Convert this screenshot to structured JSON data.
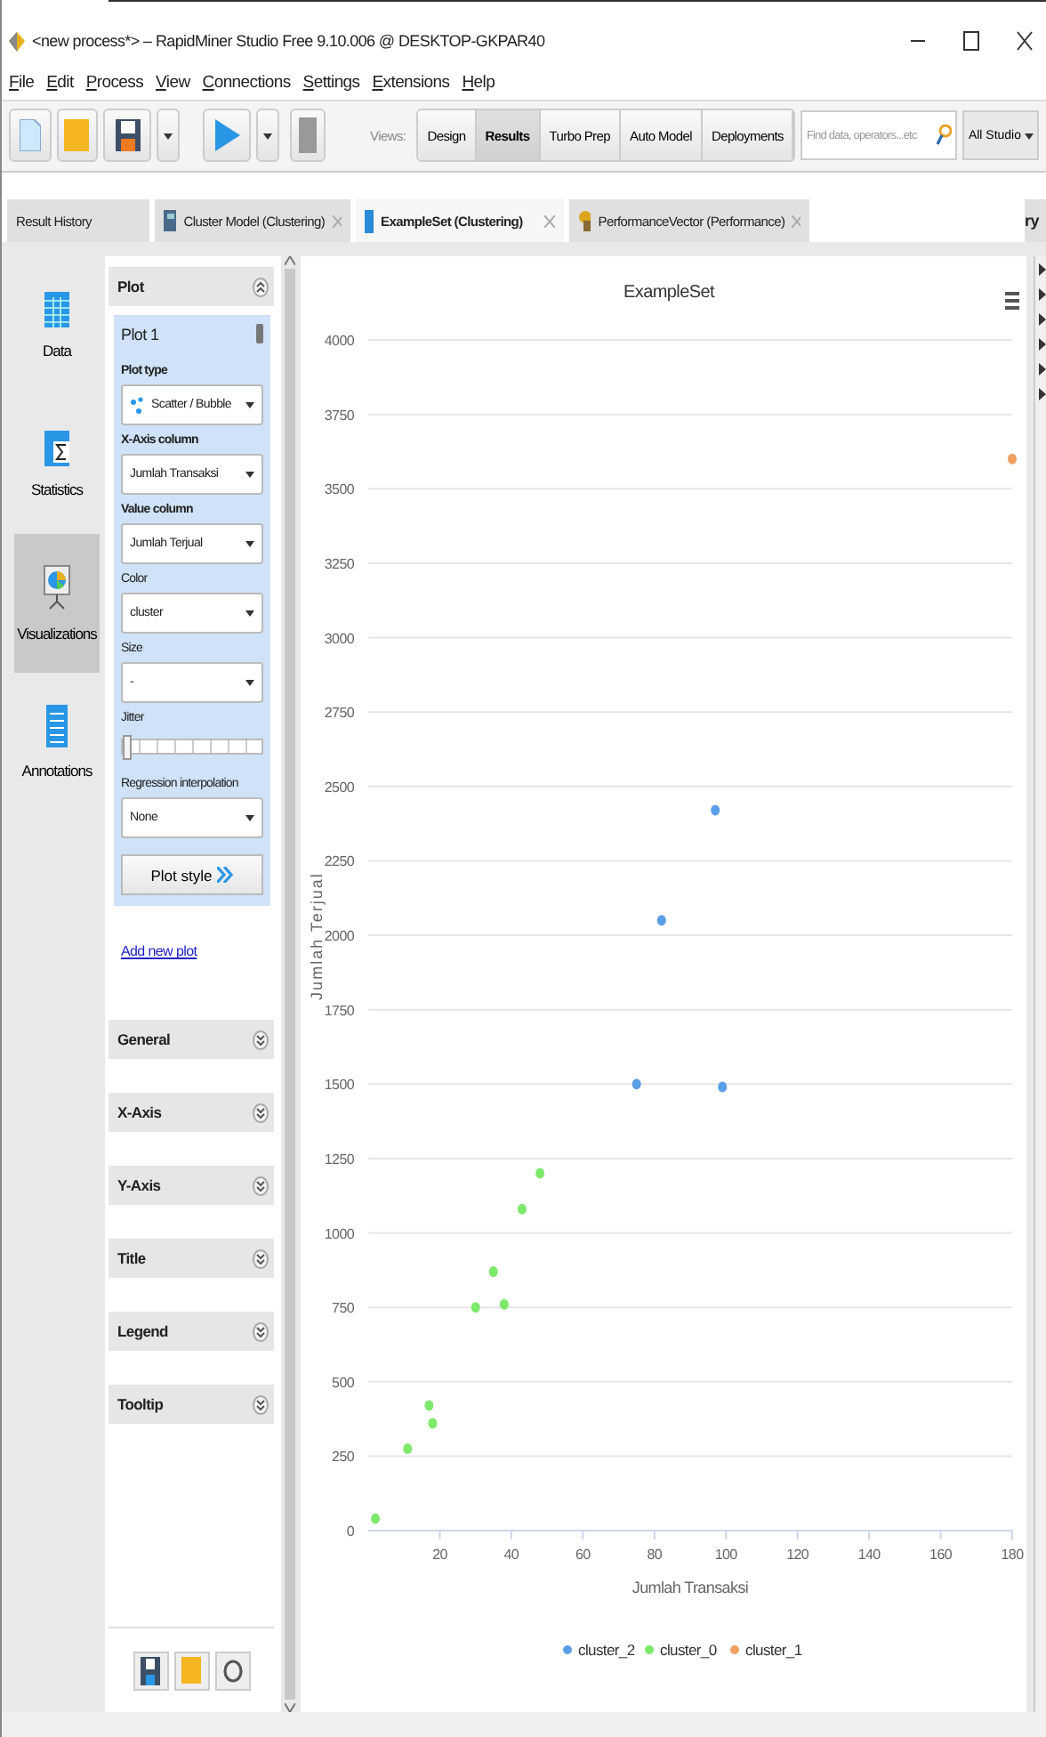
{
  "window": {
    "title": "<new process*> – RapidMiner Studio Free 9.10.006 @ DESKTOP-GKPAR40"
  },
  "menu": [
    "File",
    "Edit",
    "Process",
    "View",
    "Connections",
    "Settings",
    "Extensions",
    "Help"
  ],
  "toolbar": {
    "views_label": "Views:",
    "views": [
      {
        "label": "Design",
        "selected": false
      },
      {
        "label": "Results",
        "selected": true
      },
      {
        "label": "Turbo Prep",
        "selected": false
      },
      {
        "label": "Auto Model",
        "selected": false
      },
      {
        "label": "Deployments",
        "selected": false
      }
    ],
    "search": {
      "placeholder": "Find data, operators...etc"
    },
    "scope": "All Studio"
  },
  "tabs": [
    {
      "label": "Result History",
      "kind": "plain",
      "selected": false
    },
    {
      "label": "Cluster Model (Clustering)",
      "kind": "model",
      "selected": false
    },
    {
      "label": "ExampleSet (Clustering)",
      "kind": "data",
      "selected": true
    },
    {
      "label": "PerformanceVector (Performance)",
      "kind": "performance",
      "selected": false
    }
  ],
  "side_tab": "ry",
  "nav": [
    {
      "label": "Data",
      "kind": "table",
      "selected": false
    },
    {
      "label": "Statistics",
      "kind": "sigma",
      "selected": false
    },
    {
      "label": "Visualizations",
      "kind": "chart",
      "selected": true
    },
    {
      "label": "Annotations",
      "kind": "notes",
      "selected": false
    }
  ],
  "plot_panel": {
    "header": "Plot",
    "card_title": "Plot 1",
    "fields": [
      {
        "label": "Plot type",
        "kind": "select",
        "value": "Scatter / Bubble",
        "bold": true,
        "icon": true
      },
      {
        "label": "X-Axis column",
        "kind": "select",
        "value": "Jumlah Transaksi",
        "bold": true
      },
      {
        "label": "Value column",
        "kind": "select",
        "value": "Jumlah Terjual",
        "bold": true
      },
      {
        "label": "Color",
        "kind": "select",
        "value": "cluster",
        "bold": false
      },
      {
        "label": "Size",
        "kind": "select",
        "value": "-",
        "bold": false
      },
      {
        "label": "Jitter",
        "kind": "slider",
        "level": 0,
        "bold": false
      },
      {
        "label": "Regression interpolation",
        "kind": "select",
        "value": "None",
        "bold": false
      }
    ],
    "button": "Plot style",
    "link": "Add new plot",
    "sections": [
      "General",
      "X-Axis",
      "Y-Axis",
      "Title",
      "Legend",
      "Tooltip"
    ]
  },
  "chart_data": {
    "type": "scatter",
    "grid": true,
    "legend": true,
    "title": "ExampleSet",
    "xlabel": "Jumlah Transaksi",
    "ylabel": "Jumlah Terjual",
    "xlim": [
      0,
      180
    ],
    "ylim": [
      0,
      4000
    ],
    "xticks": [
      20,
      40,
      60,
      80,
      100,
      120,
      140,
      160,
      180
    ],
    "yticks": [
      0,
      250,
      500,
      750,
      1000,
      1250,
      1500,
      1750,
      2000,
      2250,
      2500,
      2750,
      3000,
      3250,
      3500,
      3750,
      4000
    ],
    "series": [
      {
        "name": "cluster_2",
        "color": "#5b9ee8",
        "x": [
          97,
          82,
          75,
          99
        ],
        "values": [
          2420,
          2050,
          1500,
          1490
        ]
      },
      {
        "name": "cluster_0",
        "color": "#7ee86a",
        "x": [
          2,
          11,
          17,
          18,
          30,
          35,
          38,
          43,
          48
        ],
        "values": [
          40,
          275,
          420,
          360,
          750,
          870,
          760,
          1080,
          1200
        ]
      },
      {
        "name": "cluster_1",
        "color": "#f0a060",
        "x": [
          180
        ],
        "values": [
          3600
        ]
      }
    ]
  }
}
